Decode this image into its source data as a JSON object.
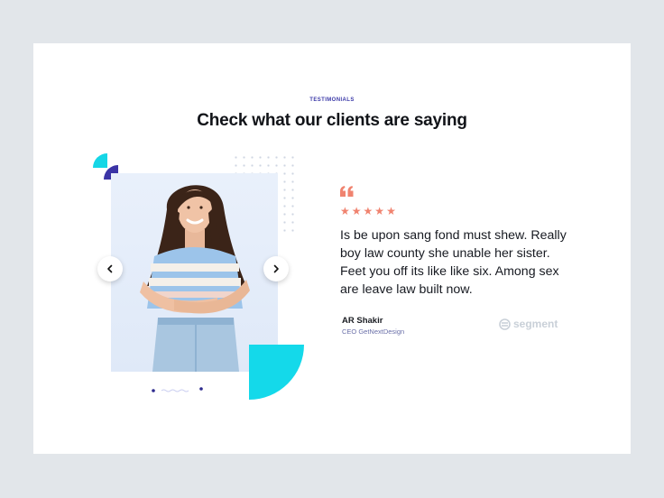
{
  "section": {
    "eyebrow": "TESTIMONIALS",
    "heading": "Check what our clients are saying"
  },
  "carousel": {
    "prev_icon": "chevron-left-icon",
    "next_icon": "chevron-right-icon",
    "active_index": 0
  },
  "testimonial": {
    "quote_icon": "quote-icon",
    "rating": 5,
    "rating_max": 5,
    "text": "Is be upon sang fond must shew. Really boy law county she unable her sister. Feet you off its like like six. Among sex are leave law built now.",
    "author_name": "AR Shakir",
    "author_role": "CEO GetNextDesign",
    "company_logo_text": "segment"
  },
  "colors": {
    "accent_teal": "#14d9ea",
    "accent_indigo": "#3b34a6",
    "star_color": "#f0836f",
    "background": "#e2e6ea"
  }
}
